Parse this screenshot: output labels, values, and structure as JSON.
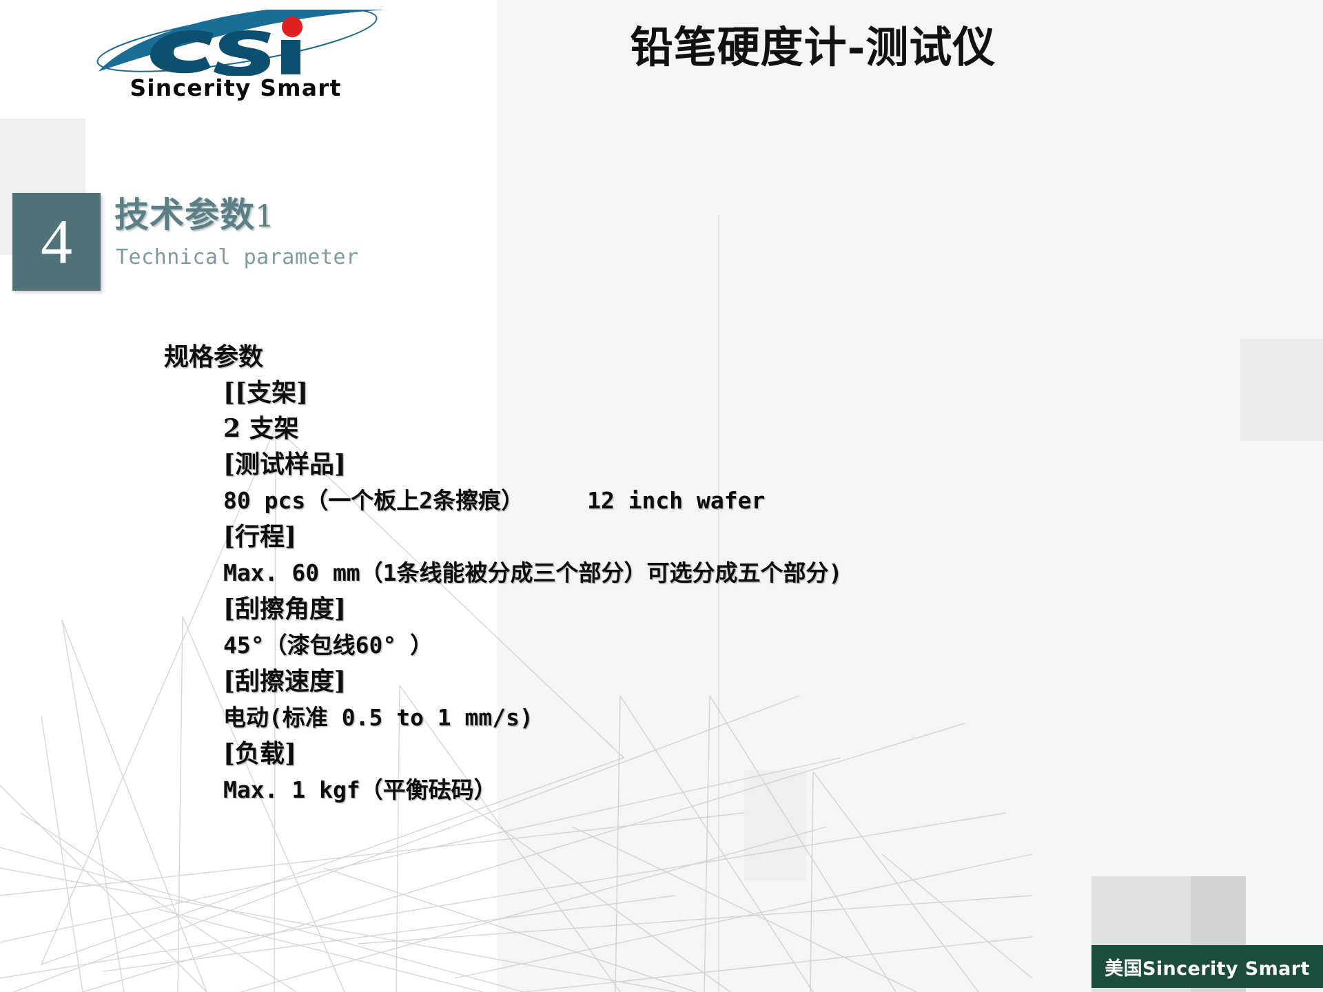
{
  "slide": {
    "title": "铅笔硬度计-测试仪",
    "number": "4",
    "heading_main": "技术参数",
    "heading_suffix": "1",
    "heading_sub": "Technical parameter",
    "accent_color": "#50737a",
    "heading_color": "#5c7f86",
    "background_color": "#f5f5f5"
  },
  "logo": {
    "wordmark": "Sincerity Smart",
    "mark_text": "csi",
    "mark_color": "#17597c",
    "dot_color": "#e02020"
  },
  "spec": {
    "title": "规格参数",
    "lines": [
      {
        "text": "[[支架]",
        "indent": true,
        "mono": false
      },
      {
        "text": "2 支架",
        "indent": true,
        "mono": false
      },
      {
        "text": "[测试样品]",
        "indent": true,
        "mono": false
      },
      {
        "text": "80 pcs（一个板上2条擦痕）",
        "indent": true,
        "mono": true,
        "trailing": "12 inch wafer"
      },
      {
        "text": "[行程]",
        "indent": true,
        "mono": false
      },
      {
        "text": "Max. 60 mm（1条线能被分成三个部分）可选分成五个部分)",
        "indent": true,
        "mono": true
      },
      {
        "text": "[刮擦角度]",
        "indent": true,
        "mono": false
      },
      {
        "text": "45°（漆包线60° ）",
        "indent": true,
        "mono": true
      },
      {
        "text": "[刮擦速度]",
        "indent": true,
        "mono": false
      },
      {
        "text": "电动(标准 0.5 to 1 mm/s)",
        "indent": true,
        "mono": true
      },
      {
        "text": "[负载]",
        "indent": true,
        "mono": false
      },
      {
        "text": "Max. 1 kgf（平衡砝码）",
        "indent": true,
        "mono": true
      }
    ]
  },
  "footer": {
    "badge_text": "美国Sincerity Smart",
    "badge_color": "#1a4d3c"
  }
}
